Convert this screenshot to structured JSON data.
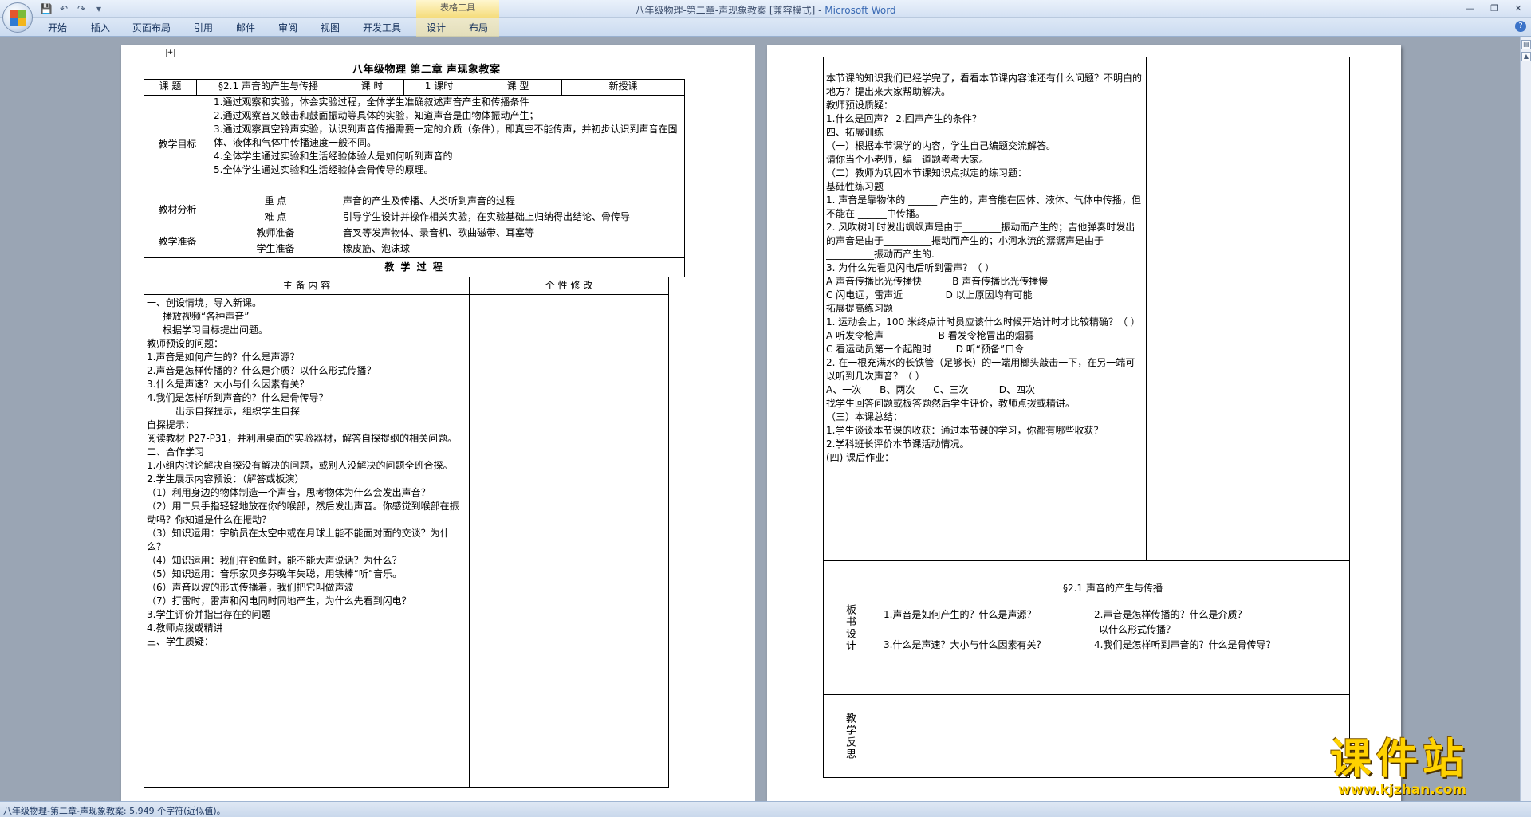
{
  "window": {
    "title": "八年级物理-第二章-声现象教案 [兼容模式] - ",
    "app_name": "Microsoft Word",
    "context_tools_label": "表格工具"
  },
  "ribbon_tabs": [
    "开始",
    "插入",
    "页面布局",
    "引用",
    "邮件",
    "审阅",
    "视图",
    "开发工具",
    "设计",
    "布局"
  ],
  "status_bar": {
    "text": "八年级物理-第二章-声现象教案: 5,949 个字符(近似值)。"
  },
  "watermark": {
    "logo": "课件站",
    "url": "www.kjzhan.com"
  },
  "page1": {
    "title": "八年级物理  第二章  声现象教案",
    "header_row": [
      "课  题",
      "§2.1 声音的产生与传播",
      "课  时",
      "1 课时",
      "课  型",
      "新授课"
    ],
    "goals_label": "教学目标",
    "goals": [
      "1.通过观察和实验，体会实验过程，全体学生准确叙述声音产生和传播条件",
      "2.通过观察音叉敲击和鼓面振动等具体的实验，知道声音是由物体振动产生；",
      "3.通过观察真空铃声实验，认识到声音传播需要一定的介质（条件），即真空不能传声，并初步认识到声音在固体、液体和气体中传播速度一般不同。",
      "4.全体学生通过实验和生活经验体验人是如何听到声音的",
      "5.全体学生通过实验和生活经验体会骨传导的原理。"
    ],
    "analysis_label": "教材分析",
    "analysis": [
      {
        "label": "重  点",
        "text": "声音的产生及传播、人类听到声音的过程"
      },
      {
        "label": "难  点",
        "text": "引导学生设计并操作相关实验，在实验基础上归纳得出结论、骨传导"
      }
    ],
    "prep_label": "教学准备",
    "prep": [
      {
        "label": "教师准备",
        "text": "音叉等发声物体、录音机、歌曲磁带、耳塞等"
      },
      {
        "label": "学生准备",
        "text": "橡皮筋、泡沫球"
      }
    ],
    "process_title": "教  学  过  程",
    "col_main": "主  备  内  容",
    "col_personal": "个  性  修  改",
    "content": [
      "一、创设情境，导入新课。",
      "    播放视频“各种声音”",
      "    根据学习目标提出问题。",
      "教师预设的问题：",
      "1.声音是如何产生的？什么是声源？",
      "2.声音是怎样传播的？什么是介质？以什么形式传播？",
      "3.什么是声速？大小与什么因素有关？",
      "4.我们是怎样听到声音的？什么是骨传导？",
      "      出示自探提示，组织学生自探",
      "自探提示：",
      "阅读教材 P27-P31，并利用桌面的实验器材，解答自探提纲的相关问题。",
      "二、合作学习",
      "1.小组内讨论解决自探没有解决的问题，或别人没解决的问题全班合探。",
      "2.学生展示内容预设：（解答或板演）",
      "（1）利用身边的物体制造一个声音，思考物体为什么会发出声音？",
      "（2）用二只手指轻轻地放在你的喉部，然后发出声音。你感觉到喉部在振动吗？你知道是什么在振动？",
      "（3）知识运用：宇航员在太空中或在月球上能不能面对面的交谈？为什么？",
      "（4）知识运用：我们在钓鱼时，能不能大声说话？为什么？",
      "（5）知识运用：音乐家贝多芬晚年失聪，用铁棒“听”音乐。",
      "（6）声音以波的形式传播着，我们把它叫做声波",
      "（7）打雷时，雷声和闪电同时同地产生，为什么先看到闪电？",
      "3.学生评价并指出存在的问题",
      "4.教师点拨或精讲",
      "三、学生质疑："
    ]
  },
  "page2": {
    "content": [
      "    本节课的知识我们已经学完了，看看本节课内容谁还有什么问题？不明白的地方？提出来大家帮助解决。",
      "教师预设质疑：",
      "1.什么是回声？    2.回声产生的条件？",
      "四、拓展训练",
      "（一）根据本节课学的内容，学生自己编题交流解答。",
      "请你当个小老师，编一道题考考大家。",
      "（二）教师为巩固本节课知识点拟定的练习题：",
      "基础性练习题",
      "1. 声音是靠物体的  ______  产生的，声音能在固体、液体、气体中传播，但不能在  ______中传播。",
      "2. 风吹树叶时发出飒飒声是由于________振动而产生的；吉他弹奏时发出的声音是由于__________振动而产生的；小河水流的潺潺声是由于__________振动而产生的.",
      "3. 为什么先看见闪电后听到雷声？（    ）",
      "A 声音传播比光传播快          B 声音传播比光传播慢",
      "C 闪电远，雷声近              D 以上原因均有可能",
      "拓展提高练习题",
      "1. 运动会上，100 米终点计时员应该什么时候开始计时才比较精确？（ ）",
      "A 听发令枪声                  B 看发令枪冒出的烟雾",
      "C 看运动员第一个起跑时        D 听“预备”口令",
      "2. 在一根充满水的长铁管（足够长）的一端用榔头敲击一下，在另一端可以听到几次声音？（    ）",
      "A、一次      B、两次      C、三次          D、四次",
      "找学生回答问题或板答题然后学生评价，教师点拨或精讲。",
      "（三）本课总结：",
      "1.学生谈谈本节课的收获：通过本节课的学习，你都有哪些收获？",
      "2.学科班长评价本节课活动情况。",
      "(四) 课后作业："
    ],
    "board_label": "板书设计",
    "board_title": "§2.1 声音的产生与传播",
    "board_items": [
      "1.声音是如何产生的？什么是声源？",
      "2.声音是怎样传播的？什么是介质？",
      "以什么形式传播？",
      "3.什么是声速？大小与什么因素有关？",
      "4.我们是怎样听到声音的？什么是骨传导？"
    ],
    "reflection_label": "教学反思"
  }
}
